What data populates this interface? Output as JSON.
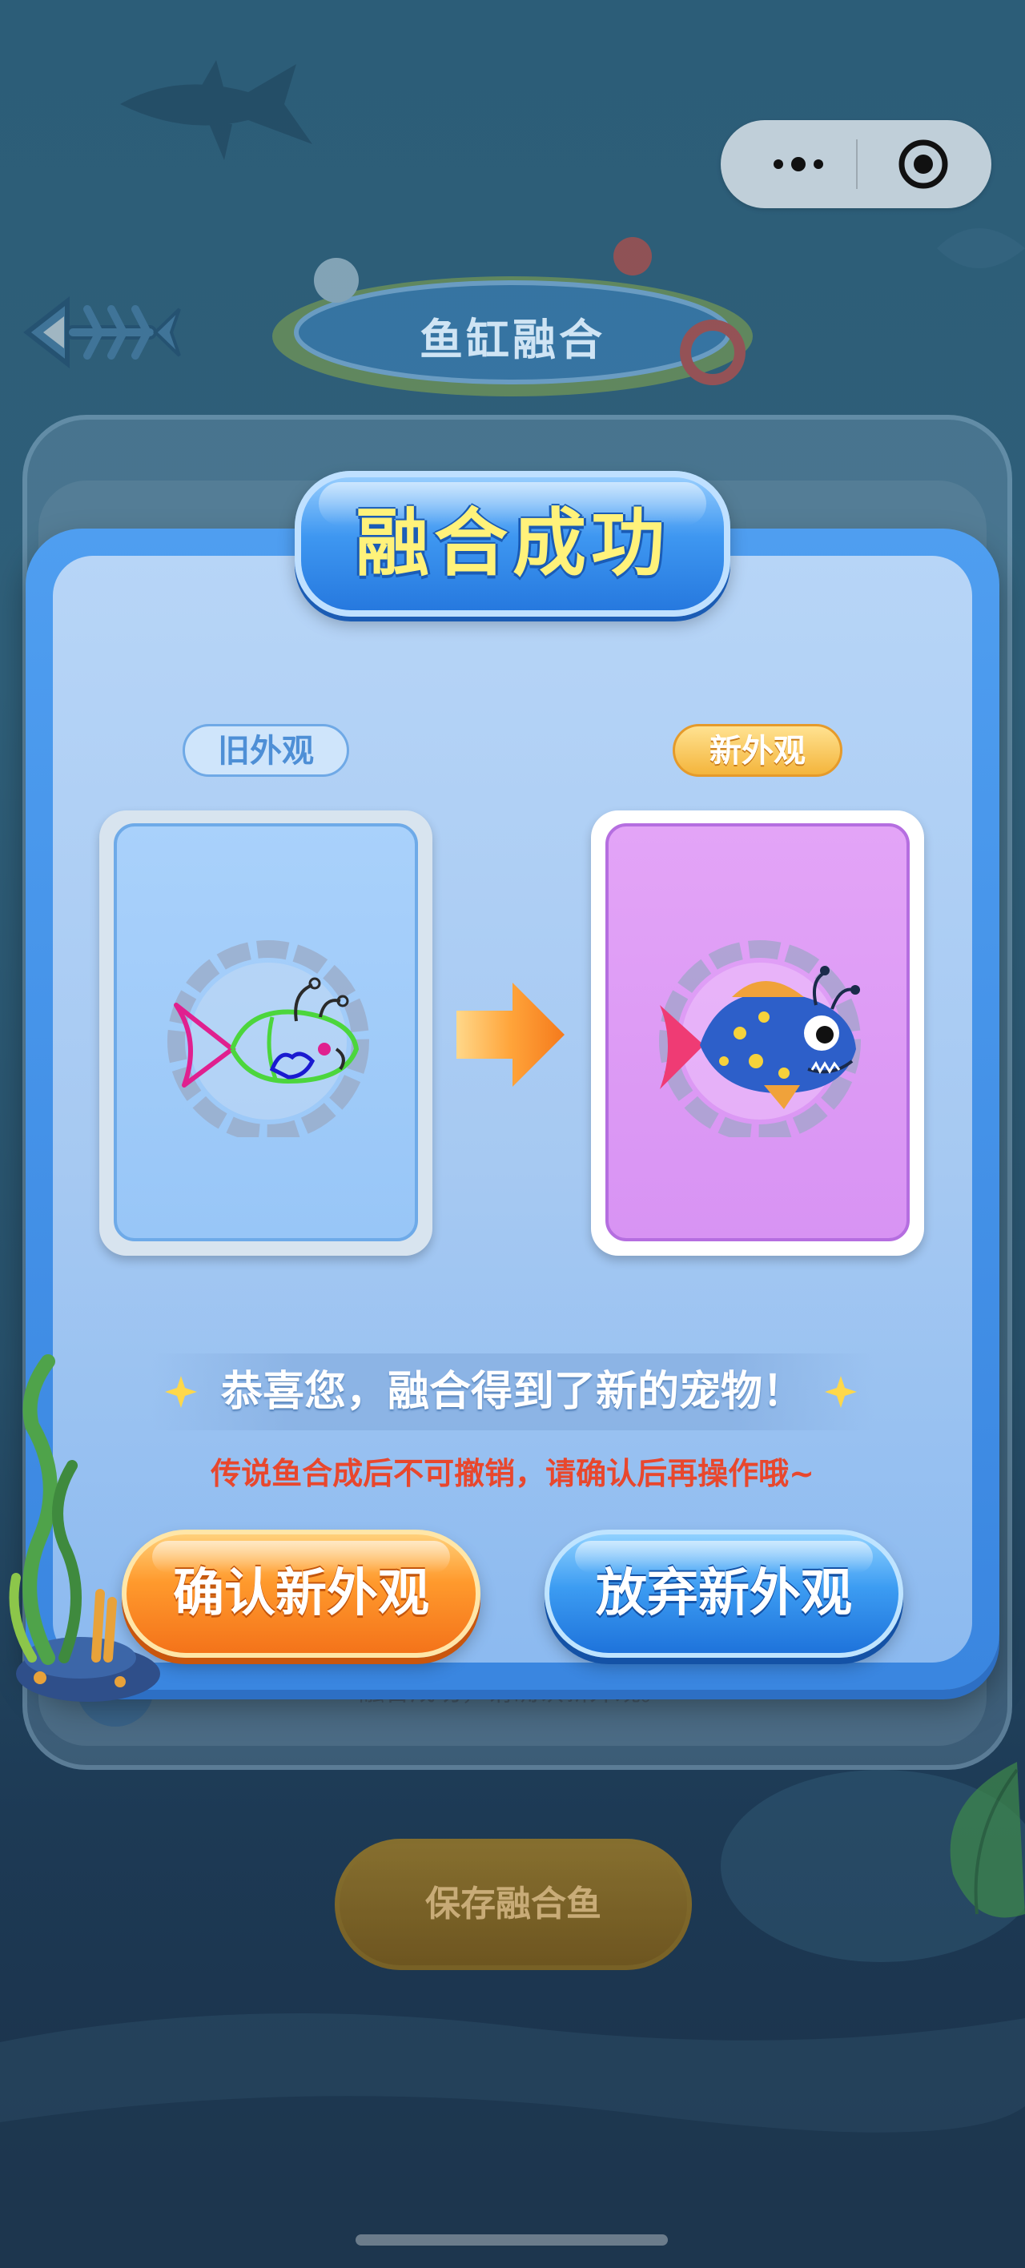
{
  "header": {
    "title": "鱼缸融合"
  },
  "capsule": {
    "more_icon": "more-dots-icon",
    "close_icon": "target-circle-icon"
  },
  "dialog": {
    "title": "融合成功",
    "old_label": "旧外观",
    "new_label": "新外观",
    "congrats": "恭喜您，融合得到了新的宠物！",
    "warning": "传说鱼合成后不可撤销，请确认后再操作哦~",
    "confirm_button": "确认新外观",
    "abandon_button": "放弃新外观"
  },
  "background_panel": {
    "hint_text": "融合成功，请确认新外观。",
    "save_button": "保存融合鱼"
  },
  "colors": {
    "dialog_blue": "#3a86e0",
    "title_yellow": "#fff27a",
    "warning_red": "#e8472d",
    "confirm_orange": "#ff9a2d",
    "abandon_blue": "#3c9cf2",
    "new_card_purple": "#d893f3",
    "old_card_blue": "#a9d1fb"
  }
}
